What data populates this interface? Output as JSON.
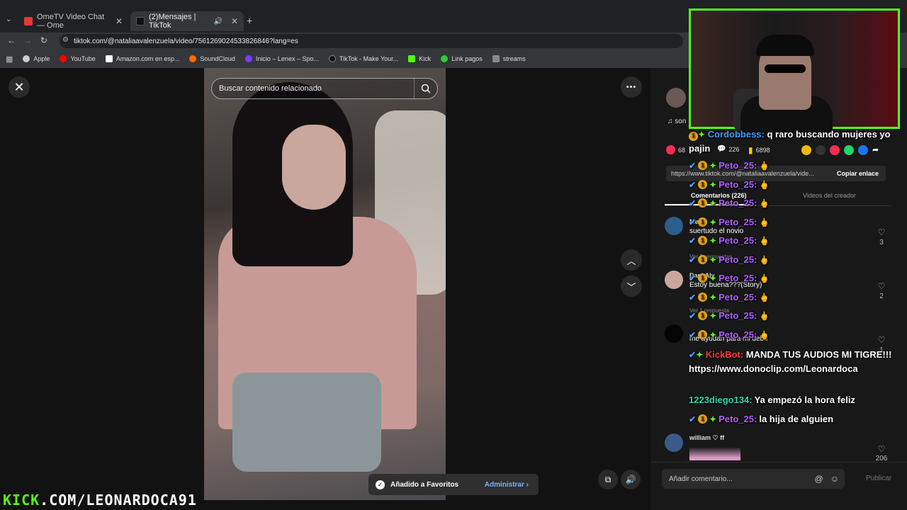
{
  "browser": {
    "tabs": [
      {
        "label": "OmeTV Video Chat — Ome",
        "favicon_color": "#e53935"
      },
      {
        "label": "(2)Mensajes | TikTok",
        "favicon_color": "#111111"
      }
    ],
    "new_tab": "+",
    "url": "tiktok.com/@nataliaavalenzuela/video/7561269024533826846?lang=es",
    "bookmarks": [
      {
        "label": "Apple",
        "color": "#cccccc"
      },
      {
        "label": "YouTube",
        "color": "#ff0000"
      },
      {
        "label": "Amazon.com en esp...",
        "color": "#ffffff"
      },
      {
        "label": "SoundCloud",
        "color": "#ff6a00"
      },
      {
        "label": "Inicio – Lenex – Spo...",
        "color": "#7a3cff"
      },
      {
        "label": "TikTok - Make Your...",
        "color": "#111111"
      },
      {
        "label": "Kick",
        "color": "#53fc18"
      },
      {
        "label": "Link pagos",
        "color": "#2ecc40"
      },
      {
        "label": "streams",
        "color": "#888888"
      }
    ]
  },
  "video": {
    "search_placeholder": "Buscar contenido relacionado",
    "more": "•••"
  },
  "toast": {
    "message": "Añadido a Favoritos",
    "action": "Administrar"
  },
  "post": {
    "music_prefix": "son",
    "stats": {
      "likes": "68",
      "comments": "226",
      "saves": "6898"
    },
    "link": "https://www.tiktok.com/@nataliaavalenzuela/vide...",
    "copy_label": "Copiar enlace",
    "tab_comments": "Comentarios (226)",
    "tab_videos": "Videos del creador"
  },
  "comments": [
    {
      "name": "Mel",
      "text": "suertudo el novio",
      "meta": "Ver 3 respuestas",
      "likes": "3",
      "avatar": "#2b5e8a"
    },
    {
      "name": "Dani Aly",
      "text": "Estoy buena???(Story)",
      "meta": "Ver 1 respuesta",
      "likes": "2",
      "avatar": "#c9a79c"
    },
    {
      "name": "",
      "text": "me ayudan para mi debu",
      "meta": "",
      "likes": "1",
      "avatar": "#050505"
    },
    {
      "name": "william ♡ ff",
      "text": "",
      "meta": "",
      "likes": "206",
      "avatar": "#3a5a8a"
    }
  ],
  "comment_input": {
    "placeholder": "Añadir comentario...",
    "post": "Publicar"
  },
  "chat": [
    {
      "user": "Cordobbess:",
      "msg": "q raro buscando mujeres yo pajin",
      "color": "user2"
    },
    {
      "user": "Peto_25:",
      "msg": "",
      "color": "user"
    },
    {
      "user": "Peto_25:",
      "msg": "",
      "color": "user"
    },
    {
      "user": "Peto_25:",
      "msg": "",
      "color": "user"
    },
    {
      "user": "Peto_25:",
      "msg": "",
      "color": "user"
    },
    {
      "user": "Peto_25:",
      "msg": "",
      "color": "user"
    },
    {
      "user": "Peto_25:",
      "msg": "",
      "color": "user"
    },
    {
      "user": "Peto_25:",
      "msg": "",
      "color": "user"
    },
    {
      "user": "Peto_25:",
      "msg": "",
      "color": "user"
    },
    {
      "user": "Peto_25:",
      "msg": "",
      "color": "user"
    },
    {
      "user": "Peto_25:",
      "msg": "",
      "color": "user"
    },
    {
      "user": "KickBot:",
      "msg": "MANDA TUS AUDIOS MI TIGRE!!! https://www.donoclip.com/Leonardoca",
      "color": "user3"
    },
    {
      "user": "1223diego134:",
      "msg": "Ya empezó la hora feliz",
      "color": "user4"
    },
    {
      "user": "Peto_25:",
      "msg": "la hija de alguien",
      "color": "user"
    }
  ],
  "banner": {
    "kick": "KICK",
    "rest": ".COM/LEONARDOCA91"
  },
  "colors": {
    "kick_green": "#53fc18",
    "tiktok_red": "#fe2c55"
  }
}
